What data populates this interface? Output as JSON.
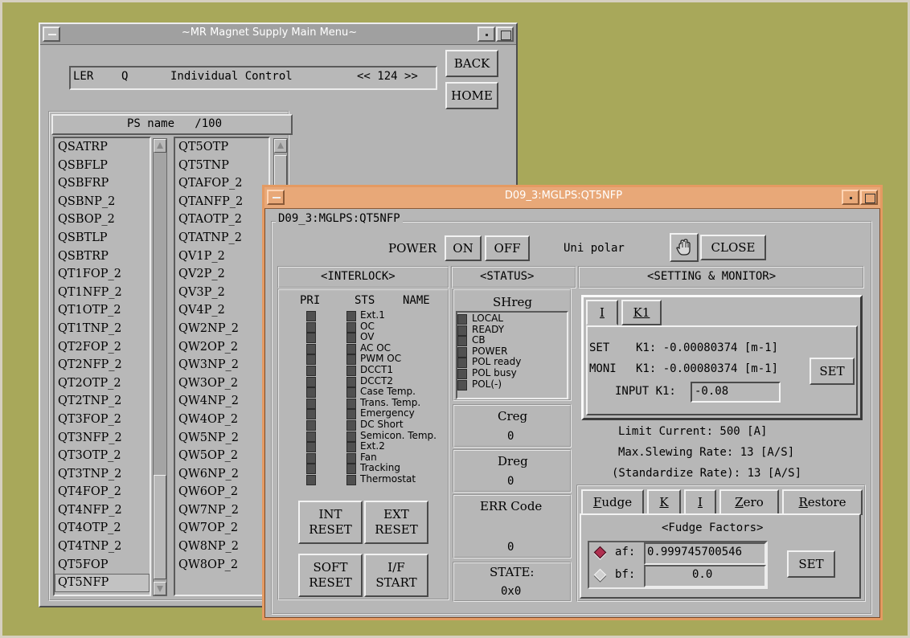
{
  "menu_window": {
    "title": "~MR Magnet Supply Main Menu~",
    "header": {
      "ring": "LER",
      "family": "Q",
      "mode": "Individual Control",
      "pager": "<< 124 >>"
    },
    "back_label": "BACK",
    "home_label": "HOME",
    "list_header": "PS name   /100",
    "list1": [
      "QSATRP",
      "QSBFLP",
      "QSBFRP",
      "QSBNP_2",
      "QSBOP_2",
      "QSBTLP",
      "QSBTRP",
      "QT1FOP_2",
      "QT1NFP_2",
      "QT1OTP_2",
      "QT1TNP_2",
      "QT2FOP_2",
      "QT2NFP_2",
      "QT2OTP_2",
      "QT2TNP_2",
      "QT3FOP_2",
      "QT3NFP_2",
      "QT3OTP_2",
      "QT3TNP_2",
      "QT4FOP_2",
      "QT4NFP_2",
      "QT4OTP_2",
      "QT4TNP_2",
      "QT5FOP",
      "QT5NFP"
    ],
    "list1_selected": "QT5NFP",
    "list2": [
      "QT5OTP",
      "QT5TNP",
      "QTAFOP_2",
      "QTANFP_2",
      "QTAOTP_2",
      "QTATNP_2",
      "QV1P_2",
      "QV2P_2",
      "QV3P_2",
      "QV4P_2",
      "QW2NP_2",
      "QW2OP_2",
      "QW3NP_2",
      "QW3OP_2",
      "QW4NP_2",
      "QW4OP_2",
      "QW5NP_2",
      "QW5OP_2",
      "QW6NP_2",
      "QW6OP_2",
      "QW7NP_2",
      "QW7OP_2",
      "QW8NP_2",
      "QW8OP_2"
    ]
  },
  "ps_window": {
    "title": "D09_3:MGLPS:QT5NFP",
    "frame_label": "D09_3:MGLPS:QT5NFP",
    "power_label": "POWER",
    "on_label": "ON",
    "off_label": "OFF",
    "polarity": "Uni polar",
    "close_label": "CLOSE",
    "interlock_header": "<INTERLOCK>",
    "status_header": "<STATUS>",
    "setting_header": "<SETTING & MONITOR>",
    "col_pri": "PRI",
    "col_sts": "STS",
    "col_name": "NAME",
    "interlocks": [
      "Ext.1",
      "OC",
      "OV",
      "AC OC",
      "PWM OC",
      "DCCT1",
      "DCCT2",
      "Case Temp.",
      "Trans. Temp.",
      "Emergency",
      "DC Short",
      "Semicon. Temp.",
      "Ext.2",
      "Fan",
      "Tracking",
      "Thermostat"
    ],
    "int_reset": "INT\nRESET",
    "ext_reset": "EXT\nRESET",
    "soft_reset": "SOFT\nRESET",
    "if_start": "I/F\nSTART",
    "shreg_label": "SHreg",
    "shreg_bits": [
      "LOCAL",
      "READY",
      "CB",
      "POWER",
      "POL ready",
      "POL busy",
      "POL(-)"
    ],
    "creg_label": "Creg",
    "creg_value": "0",
    "dreg_label": "Dreg",
    "dreg_value": "0",
    "err_label": "ERR Code",
    "err_value": "0",
    "state_label": "STATE:",
    "state_value": "0x0",
    "tab_i": "I",
    "tab_k1": "K1",
    "set_label": "SET",
    "set_line": "K1: -0.00080374 [m-1]",
    "moni_label": "MONI",
    "moni_line": "K1: -0.00080374 [m-1]",
    "set_button": "SET",
    "input_label": "INPUT K1:",
    "input_value": "-0.08",
    "limit_current": "Limit Current: 500 [A]",
    "max_slew": "Max.Slewing Rate: 13 [A/S]",
    "std_rate": "(Standardize Rate): 13 [A/S]",
    "tabs2": [
      "Fudge",
      "K",
      "I",
      "Zero",
      "Restore"
    ],
    "fudge_title": "<Fudge Factors>",
    "af_label": "af:",
    "af_value": "0.999745700546",
    "bf_label": "bf:",
    "bf_value": "0.0",
    "fudge_set": "SET",
    "colors": {
      "title_bar": "#e8a878",
      "led_off": "#505050",
      "radio_on": "#b03050"
    }
  }
}
